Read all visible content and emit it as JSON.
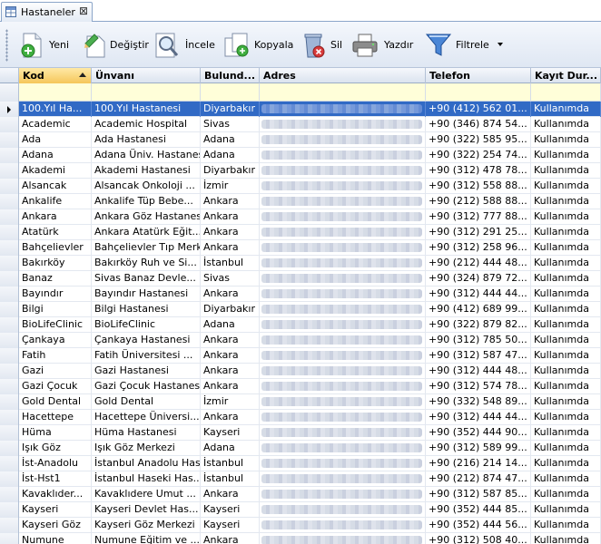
{
  "tab": {
    "label": "Hastaneler",
    "close": "⊠"
  },
  "toolbar": {
    "new_label": "Yeni",
    "edit_label": "Değiştir",
    "view_label": "İncele",
    "copy_label": "Kopyala",
    "delete_label": "Sil",
    "print_label": "Yazdır",
    "filter_label": "Filtrele"
  },
  "colors": {
    "selection": "#316ac5",
    "sorted_header": "#f5c65a",
    "filter_row": "#fffed9"
  },
  "columns": [
    "Kod",
    "Ünvanı",
    "Bulund...",
    "Adres",
    "Telefon",
    "Kayıt Dur..."
  ],
  "rows": [
    {
      "kod": "100.Yıl Ha...",
      "unvan": "100.Yıl Hastanesi",
      "il": "Diyarbakır",
      "tel": "+90 (412) 562 01...",
      "durum": "Kullanımda"
    },
    {
      "kod": "Academic",
      "unvan": "Academic Hospital",
      "il": "Sivas",
      "tel": "+90 (346) 874 54...",
      "durum": "Kullanımda"
    },
    {
      "kod": "Ada",
      "unvan": "Ada Hastanesi",
      "il": "Adana",
      "tel": "+90 (322) 585 95...",
      "durum": "Kullanımda"
    },
    {
      "kod": "Adana",
      "unvan": "Adana Üniv. Hastanesi",
      "il": "Adana",
      "tel": "+90 (322) 254 74...",
      "durum": "Kullanımda"
    },
    {
      "kod": "Akademi",
      "unvan": "Akademi Hastanesi",
      "il": "Diyarbakır",
      "tel": "+90 (312) 478 78...",
      "durum": "Kullanımda"
    },
    {
      "kod": "Alsancak",
      "unvan": "Alsancak Onkoloji ...",
      "il": "İzmir",
      "tel": "+90 (312) 558 88...",
      "durum": "Kullanımda"
    },
    {
      "kod": "Ankalife",
      "unvan": "Ankalife Tüp Bebe...",
      "il": "Ankara",
      "tel": "+90 (212) 588 88...",
      "durum": "Kullanımda"
    },
    {
      "kod": "Ankara",
      "unvan": "Ankara Göz Hastanesi",
      "il": "Ankara",
      "tel": "+90 (312) 777 88...",
      "durum": "Kullanımda"
    },
    {
      "kod": "Atatürk",
      "unvan": "Ankara Atatürk Eğit...",
      "il": "Ankara",
      "tel": "+90 (312) 291 25...",
      "durum": "Kullanımda"
    },
    {
      "kod": "Bahçelievler",
      "unvan": "Bahçelievler Tıp Merkezi",
      "il": "Ankara",
      "tel": "+90 (312) 258 96...",
      "durum": "Kullanımda"
    },
    {
      "kod": "Bakırköy",
      "unvan": "Bakırköy Ruh ve Si...",
      "il": "İstanbul",
      "tel": "+90 (212) 444 48...",
      "durum": "Kullanımda"
    },
    {
      "kod": "Banaz",
      "unvan": "Sivas Banaz Devle...",
      "il": "Sivas",
      "tel": "+90 (324) 879 72...",
      "durum": "Kullanımda"
    },
    {
      "kod": "Bayındır",
      "unvan": "Bayındır Hastanesi",
      "il": "Ankara",
      "tel": "+90 (312) 444 44...",
      "durum": "Kullanımda"
    },
    {
      "kod": "Bilgi",
      "unvan": "Bilgi Hastanesi",
      "il": "Diyarbakır",
      "tel": "+90 (412) 689 99...",
      "durum": "Kullanımda"
    },
    {
      "kod": "BioLifeClinic",
      "unvan": "BioLifeClinic",
      "il": "Adana",
      "tel": "+90 (322) 879 82...",
      "durum": "Kullanımda"
    },
    {
      "kod": "Çankaya",
      "unvan": "Çankaya Hastanesi",
      "il": "Ankara",
      "tel": "+90 (312) 785 50...",
      "durum": "Kullanımda"
    },
    {
      "kod": "Fatih",
      "unvan": "Fatih Üniversitesi ...",
      "il": "Ankara",
      "tel": "+90 (312) 587 47...",
      "durum": "Kullanımda"
    },
    {
      "kod": "Gazi",
      "unvan": "Gazi Hastanesi",
      "il": "Ankara",
      "tel": "+90 (312) 444 48...",
      "durum": "Kullanımda"
    },
    {
      "kod": "Gazi Çocuk",
      "unvan": "Gazi Çocuk Hastanesi",
      "il": "Ankara",
      "tel": "+90 (312) 574 78...",
      "durum": "Kullanımda"
    },
    {
      "kod": "Gold Dental",
      "unvan": "Gold Dental",
      "il": "İzmir",
      "tel": "+90 (332) 548 89...",
      "durum": "Kullanımda"
    },
    {
      "kod": "Hacettepe",
      "unvan": "Hacettepe Üniversi...",
      "il": "Ankara",
      "tel": "+90 (312) 444 44...",
      "durum": "Kullanımda"
    },
    {
      "kod": "Hüma",
      "unvan": "Hüma Hastanesi",
      "il": "Kayseri",
      "tel": "+90 (352) 444 90...",
      "durum": "Kullanımda"
    },
    {
      "kod": "Işık Göz",
      "unvan": "Işık Göz Merkezi",
      "il": "Adana",
      "tel": "+90 (312) 589 99...",
      "durum": "Kullanımda"
    },
    {
      "kod": "İst-Anadolu",
      "unvan": "İstanbul Anadolu Hast.",
      "il": "İstanbul",
      "tel": "+90 (216) 214 14...",
      "durum": "Kullanımda"
    },
    {
      "kod": "İst-Hst1",
      "unvan": "İstanbul Haseki Has...",
      "il": "İstanbul",
      "tel": "+90 (212) 874 47...",
      "durum": "Kullanımda"
    },
    {
      "kod": "Kavaklıder...",
      "unvan": "Kavaklıdere Umut ...",
      "il": "Ankara",
      "tel": "+90 (312) 587 85...",
      "durum": "Kullanımda"
    },
    {
      "kod": "Kayseri",
      "unvan": "Kayseri Devlet Has...",
      "il": "Kayseri",
      "tel": "+90 (352) 444 85...",
      "durum": "Kullanımda"
    },
    {
      "kod": "Kayseri Göz",
      "unvan": "Kayseri Göz Merkezi",
      "il": "Kayseri",
      "tel": "+90 (352) 444 56...",
      "durum": "Kullanımda"
    },
    {
      "kod": "Numune",
      "unvan": "Numune Eğitim ve ...",
      "il": "Ankara",
      "tel": "+90 (312) 508 40...",
      "durum": "Kullanımda"
    }
  ]
}
